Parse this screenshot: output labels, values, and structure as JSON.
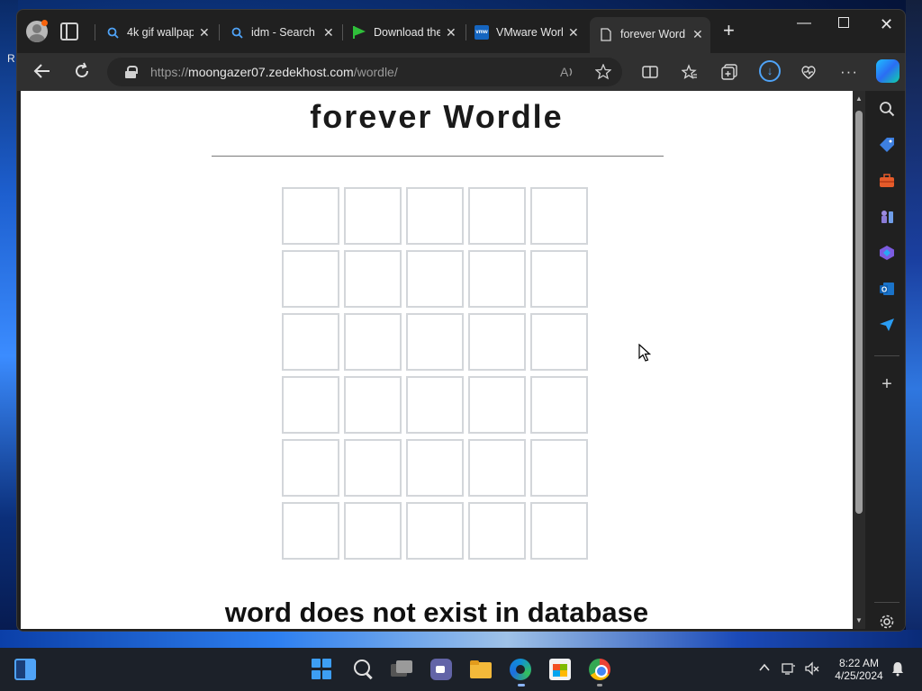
{
  "desktop": {
    "edge_text": "R"
  },
  "browser": {
    "tabs": [
      {
        "label": "4k gif wallpap",
        "icon": "search-icon"
      },
      {
        "label": "idm - Search",
        "icon": "search-icon"
      },
      {
        "label": "Download the",
        "icon": "green-flag-icon"
      },
      {
        "label": "VMware Work",
        "icon": "vmware-icon",
        "icon_text": "vmw"
      },
      {
        "label": "forever Word",
        "icon": "page-icon",
        "active": true
      }
    ],
    "address": {
      "protocol": "https://",
      "host": "moongazer07.zedekhost.com",
      "path": "/wordle/"
    }
  },
  "page": {
    "title": "forever Wordle",
    "grid": {
      "rows": 6,
      "cols": 5,
      "letters": []
    },
    "message": "word does not exist in database"
  },
  "taskbar": {
    "time": "8:22 AM",
    "date": "4/25/2024"
  },
  "colors": {
    "accent": "#4fa3f7",
    "tile_border": "#d3d6da",
    "page_bg": "#ffffff"
  }
}
